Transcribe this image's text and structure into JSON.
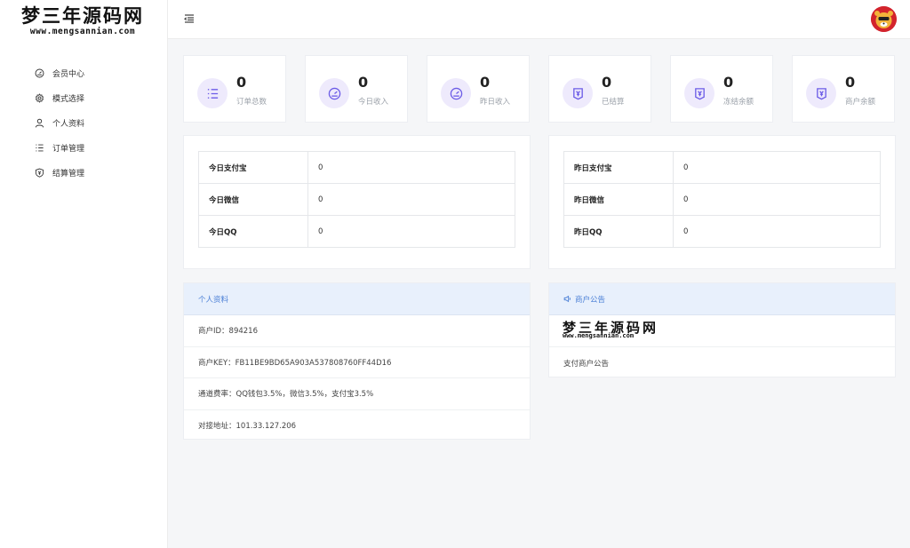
{
  "logo": {
    "main": "梦三年源码网",
    "sub": "www.mengsannian.com"
  },
  "sidebar": {
    "items": [
      {
        "label": "会员中心",
        "icon": "dashboard-icon"
      },
      {
        "label": "模式选择",
        "icon": "gear-icon"
      },
      {
        "label": "个人资料",
        "icon": "user-icon"
      },
      {
        "label": "订单管理",
        "icon": "list-icon"
      },
      {
        "label": "结算管理",
        "icon": "shield-yen-icon"
      }
    ]
  },
  "stats": [
    {
      "value": "0",
      "label": "订单总数",
      "icon": "list-icon"
    },
    {
      "value": "0",
      "label": "今日收入",
      "icon": "gauge-icon"
    },
    {
      "value": "0",
      "label": "昨日收入",
      "icon": "gauge-icon"
    },
    {
      "value": "0",
      "label": "已结算",
      "icon": "yen-badge-icon"
    },
    {
      "value": "0",
      "label": "冻结余额",
      "icon": "yen-badge-icon"
    },
    {
      "value": "0",
      "label": "商户余额",
      "icon": "yen-badge-icon"
    }
  ],
  "today": [
    {
      "key": "今日支付宝",
      "value": "0"
    },
    {
      "key": "今日微信",
      "value": "0"
    },
    {
      "key": "今日QQ",
      "value": "0"
    }
  ],
  "yesterday": [
    {
      "key": "昨日支付宝",
      "value": "0"
    },
    {
      "key": "昨日微信",
      "value": "0"
    },
    {
      "key": "昨日QQ",
      "value": "0"
    }
  ],
  "profile": {
    "title": "个人资料",
    "rows": [
      "商户ID：894216",
      "商户KEY：FB11BE9BD65A903A537808760FF44D16",
      "通道费率：QQ钱包3.5%，微信3.5%，支付宝3.5%",
      "对接地址：101.33.127.206"
    ]
  },
  "notice": {
    "title": "商户公告",
    "logo_main": "梦三年源码网",
    "logo_sub": "www.mengsannian.com",
    "text": "支付商户公告"
  },
  "colors": {
    "accent": "#4a7fd6",
    "icon_bg": "#eeeafc",
    "icon_fg": "#6c5ce7",
    "panel_head_bg": "#e8f0fc"
  }
}
